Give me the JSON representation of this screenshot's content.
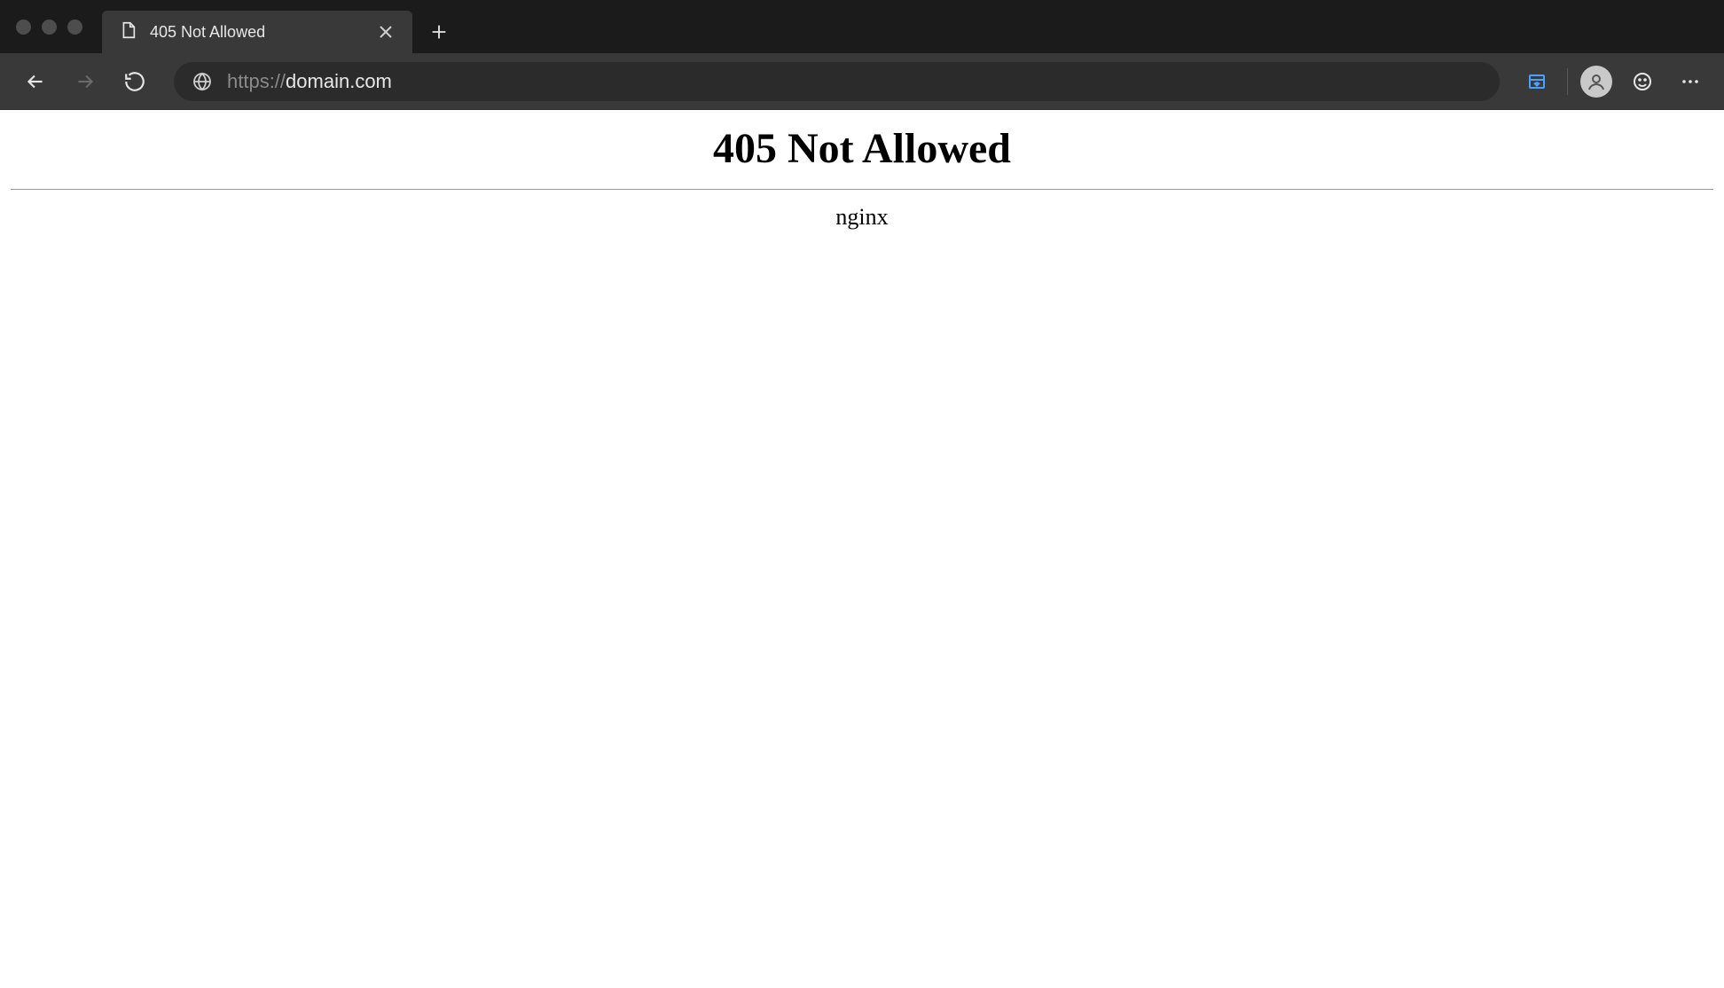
{
  "tab": {
    "title": "405 Not Allowed"
  },
  "address": {
    "scheme": "https://",
    "host": "domain.com",
    "full": "https://domain.com"
  },
  "page": {
    "heading": "405 Not Allowed",
    "server": "nginx"
  }
}
